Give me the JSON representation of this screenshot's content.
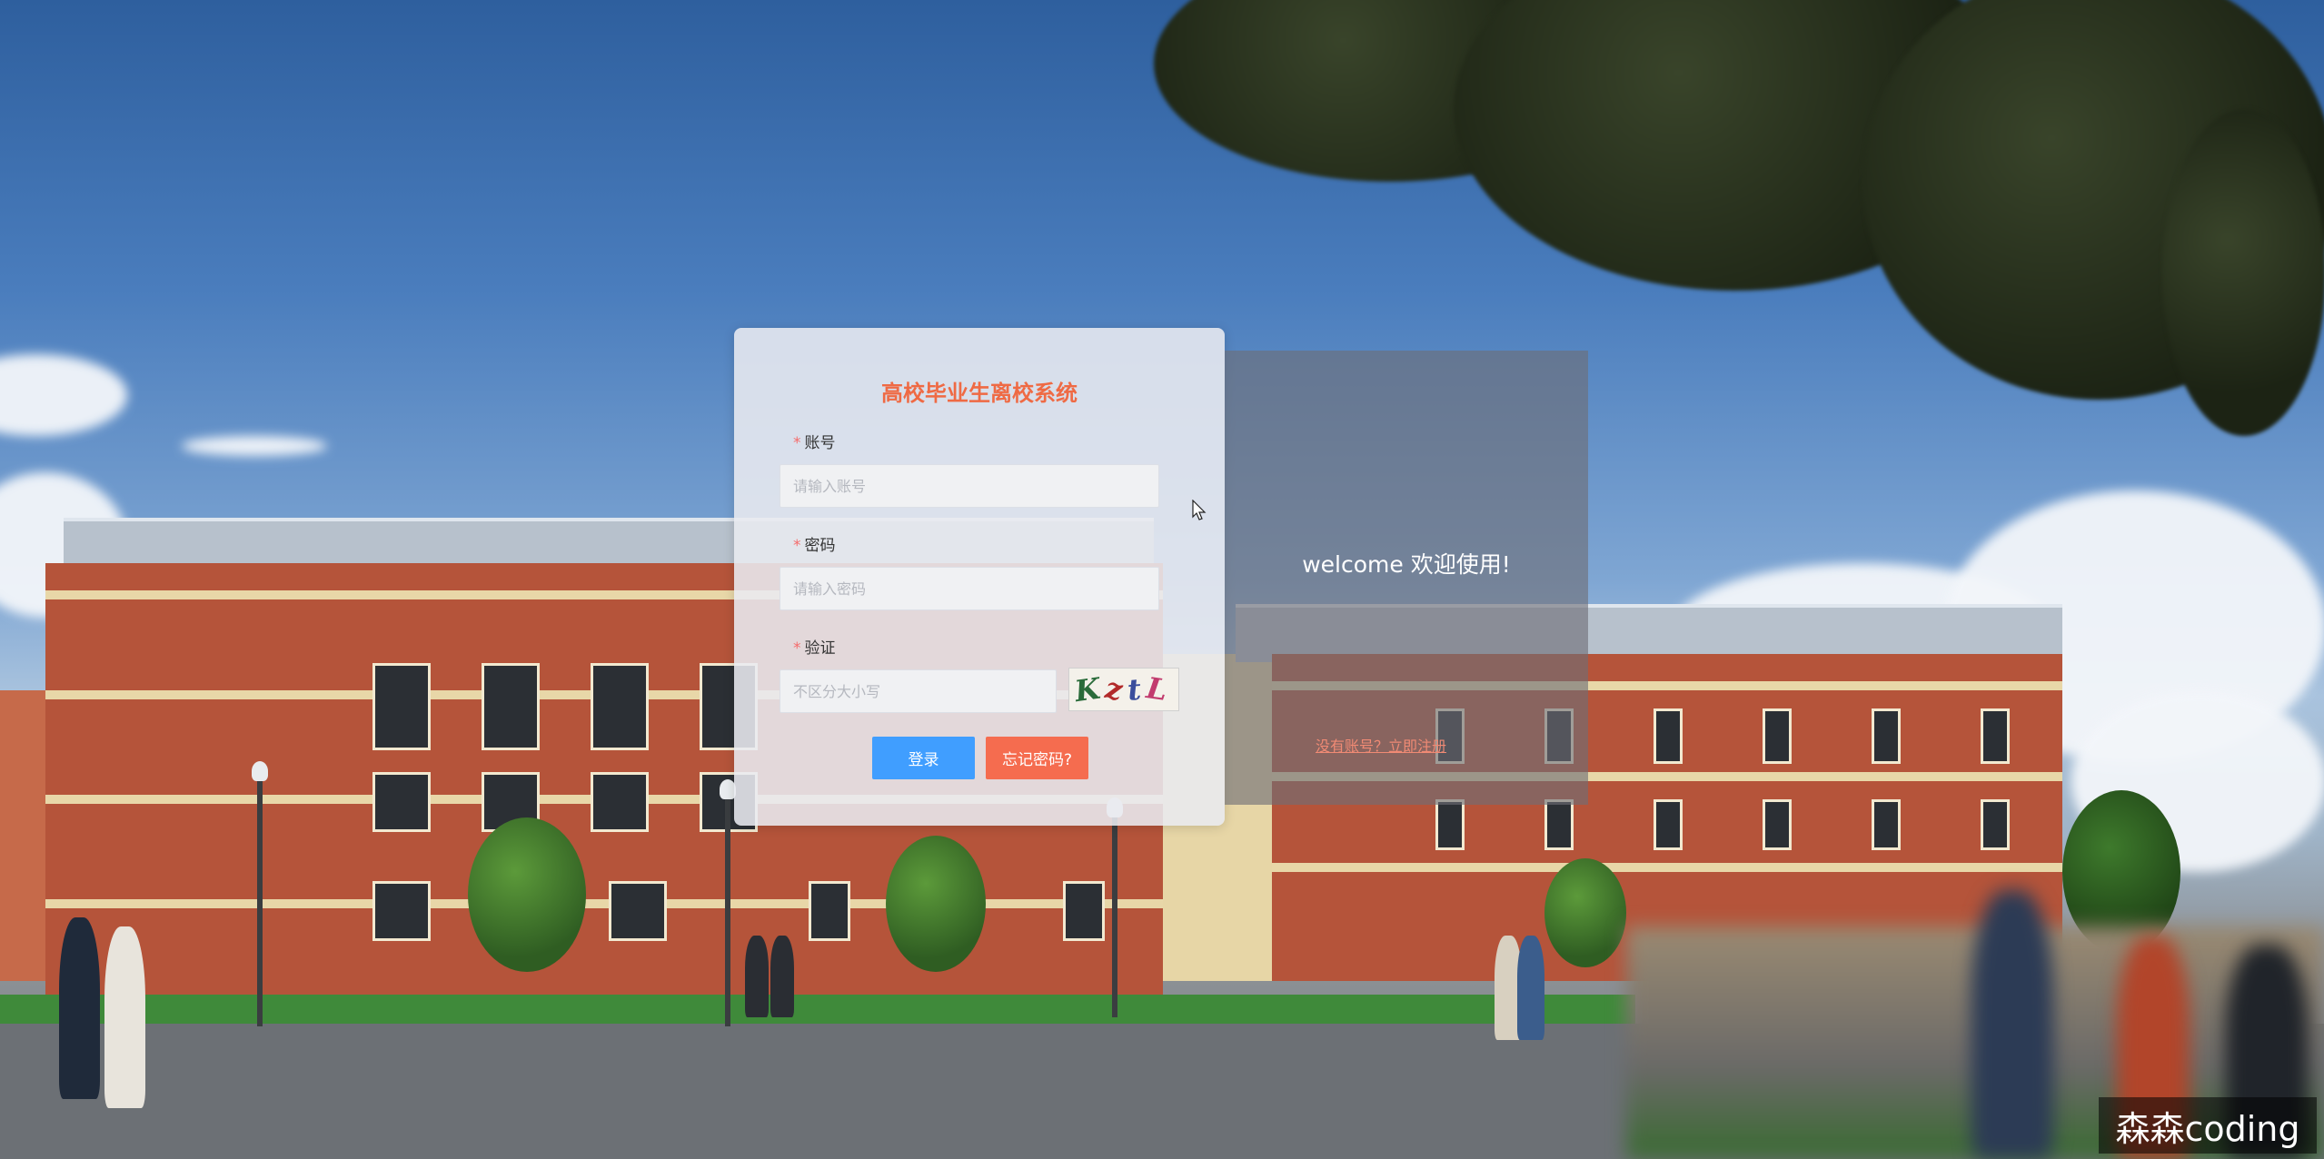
{
  "login": {
    "title": "高校毕业生离校系统",
    "account": {
      "label": "账号",
      "placeholder": "请输入账号",
      "value": ""
    },
    "password": {
      "label": "密码",
      "placeholder": "请输入密码",
      "value": ""
    },
    "captcha": {
      "label": "验证",
      "placeholder": "不区分大小写",
      "value": "",
      "image_text": [
        "K",
        "z",
        "t",
        "L"
      ]
    },
    "login_button": "登录",
    "forgot_button": "忘记密码?"
  },
  "welcome": {
    "text": "welcome 欢迎使用!",
    "register_link": "没有账号？立即注册"
  },
  "watermark": "森森coding",
  "colors": {
    "title": "#ef6a44",
    "primary_button": "#409eff",
    "danger_button": "#f56c4f",
    "required_mark": "#f56c6c",
    "register_link": "#f08a74"
  }
}
